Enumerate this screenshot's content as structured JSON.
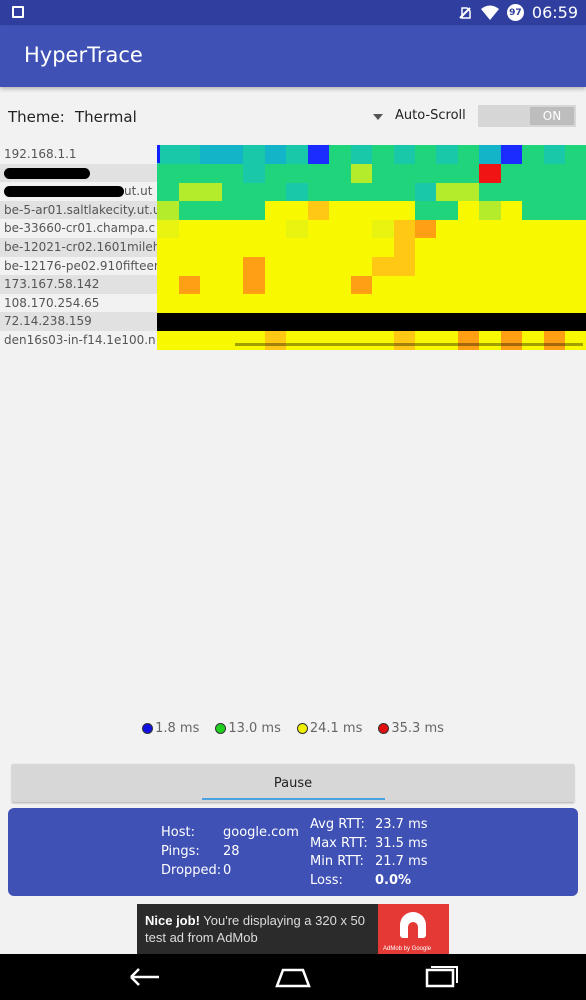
{
  "status_bar": {
    "time": "06:59",
    "battery": "97"
  },
  "app": {
    "title": "HyperTrace"
  },
  "controls": {
    "theme_label": "Theme:",
    "theme_value": "Thermal",
    "autoscroll_label": "Auto-Scroll",
    "toggle_state": "ON"
  },
  "hosts": [
    {
      "label": "192.168.1.1",
      "redacted": false
    },
    {
      "label": "",
      "redacted": true
    },
    {
      "label": "ut.ut",
      "redacted": true
    },
    {
      "label": "be-5-ar01.saltlakecity.ut.u",
      "redacted": false
    },
    {
      "label": "be-33660-cr01.champa.c",
      "redacted": false
    },
    {
      "label": "be-12021-cr02.1601mileh",
      "redacted": false
    },
    {
      "label": "be-12176-pe02.910fifteen",
      "redacted": false
    },
    {
      "label": "173.167.58.142",
      "redacted": false
    },
    {
      "label": "108.170.254.65",
      "redacted": false
    },
    {
      "label": "72.14.238.159",
      "redacted": false
    },
    {
      "label": "den16s03-in-f14.1e100.n",
      "redacted": false
    }
  ],
  "heatmap": {
    "palette": {
      "b": "#1a2cff",
      "c": "#14b4c8",
      "t": "#18c8a8",
      "g": "#20d47c",
      "l": "#6ae04c",
      "L": "#b4ec2c",
      "y": "#f8f800",
      "Y": "#e8f410",
      "o": "#ffc814",
      "O": "#ffa014",
      "r": "#f01414",
      "k": "#000000"
    },
    "rows": [
      "ttcctctbgtgtgtgcbgtg",
      "ggggtggggLgggggrgggg",
      "gLLgggtgggggtLLggggg",
      "LggggyyoyyyyggyLyggg",
      "YyyyyyYyyyYoOyyyyyyy",
      "yyyyyyyyyyyoyyyyyyyy",
      "yyyyOyyyyyooyyyyyyyy",
      "yOyyOyyyyOyyyyyyyyyy",
      "yyyyyyyyyyyyyyyyyyyy",
      "kkkkkkkkkkkkkkkkkkkk",
      "yyyyyoyyyyyoyyOyOyOy"
    ]
  },
  "legend": [
    {
      "label": "1.8 ms",
      "color": "#1010e0"
    },
    {
      "label": "13.0 ms",
      "color": "#20d020"
    },
    {
      "label": "24.1 ms",
      "color": "#f0f000"
    },
    {
      "label": "35.3 ms",
      "color": "#e01010"
    }
  ],
  "pause_label": "Pause",
  "stats": {
    "host_label": "Host:",
    "host_value": "google.com",
    "pings_label": "Pings:",
    "pings_value": "28",
    "dropped_label": "Dropped:",
    "dropped_value": "0",
    "avg_label": "Avg RTT:",
    "avg_value": "23.7 ms",
    "max_label": "Max RTT:",
    "max_value": "31.5 ms",
    "min_label": "Min RTT:",
    "min_value": "21.7 ms",
    "loss_label": "Loss:",
    "loss_value": "0.0%"
  },
  "ad": {
    "bold": "Nice job!",
    "text": " You're displaying a 320 x 50 test ad from AdMob",
    "logo_caption": "AdMob by Google"
  },
  "icons": {
    "back": "back-arrow-icon",
    "home": "home-icon",
    "recents": "recents-icon",
    "wifi": "wifi-icon",
    "no-sim": "no-sim-icon"
  }
}
